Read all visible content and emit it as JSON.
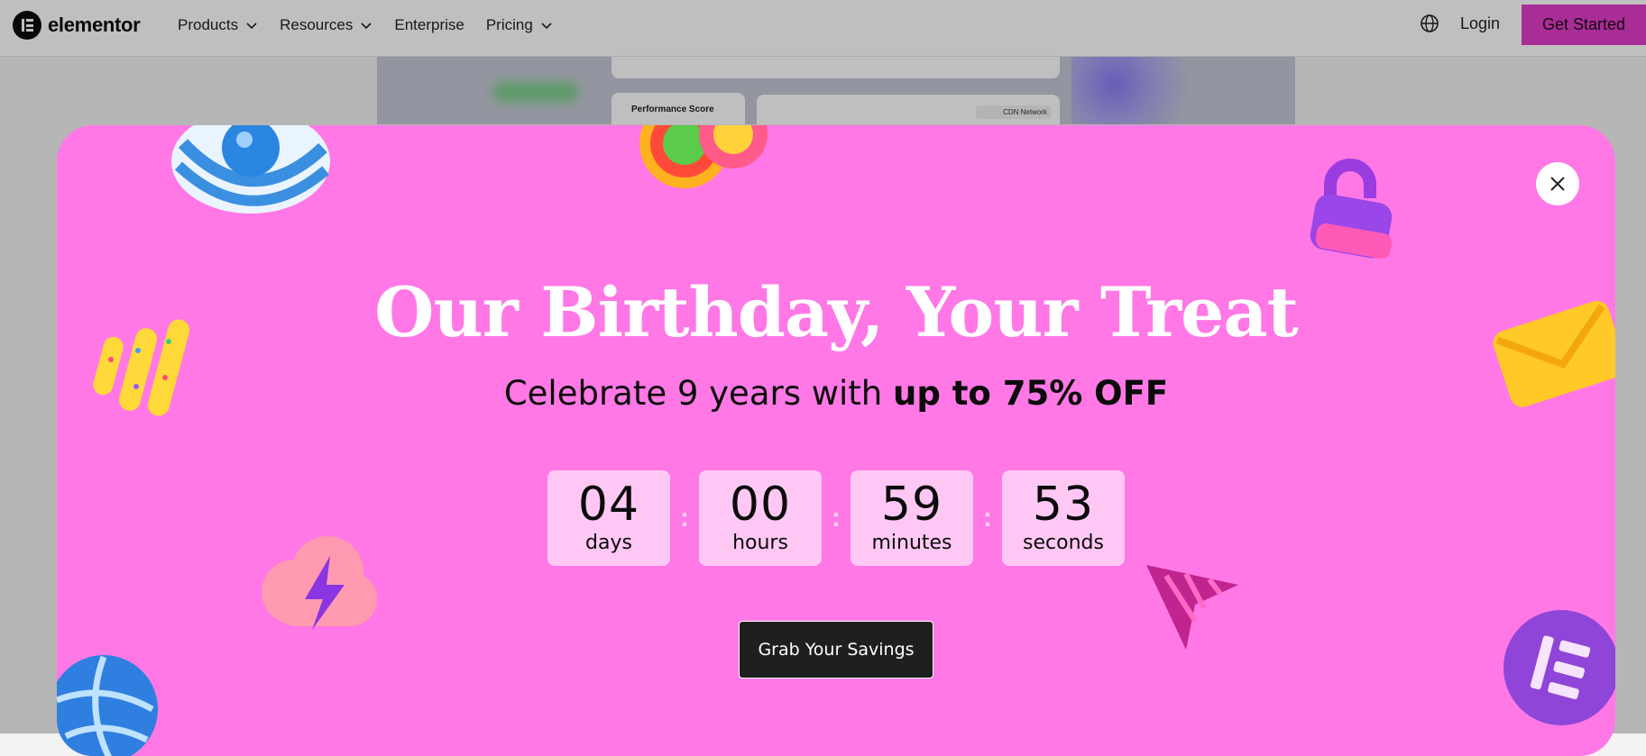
{
  "header": {
    "logo_text": "elementor",
    "nav": [
      {
        "label": "Products",
        "has_dropdown": true
      },
      {
        "label": "Resources",
        "has_dropdown": true
      },
      {
        "label": "Enterprise",
        "has_dropdown": false
      },
      {
        "label": "Pricing",
        "has_dropdown": true
      }
    ],
    "language_icon": "globe-icon",
    "login_label": "Login",
    "cta_label": "Get Started"
  },
  "background": {
    "performance_card_label": "Performance Score",
    "cdn_label": "CDN Network"
  },
  "modal": {
    "title": "Our Birthday, Your Treat",
    "subtitle_prefix": "Celebrate 9 years with ",
    "subtitle_bold": "up to 75% OFF",
    "countdown": [
      {
        "value": "04",
        "label": "days"
      },
      {
        "value": "00",
        "label": "hours"
      },
      {
        "value": "59",
        "label": "minutes"
      },
      {
        "value": "53",
        "label": "seconds"
      }
    ],
    "separator": ":",
    "cta_label": "Grab Your Savings",
    "close_icon": "close-icon",
    "decorations": [
      "striped-candy-icon",
      "lollipop-icon",
      "lock-icon",
      "envelope-icon",
      "sprinkle-sticks-icon",
      "lightning-cloud-icon",
      "cursor-arrow-icon",
      "globe-candy-icon",
      "elementor-badge-icon"
    ]
  },
  "colors": {
    "modal_bg": "#ff78e6",
    "countdown_bg": "#ffc8f4",
    "cta_bg": "#1f1f1f",
    "header_cta_bg": "#e23dc8"
  }
}
